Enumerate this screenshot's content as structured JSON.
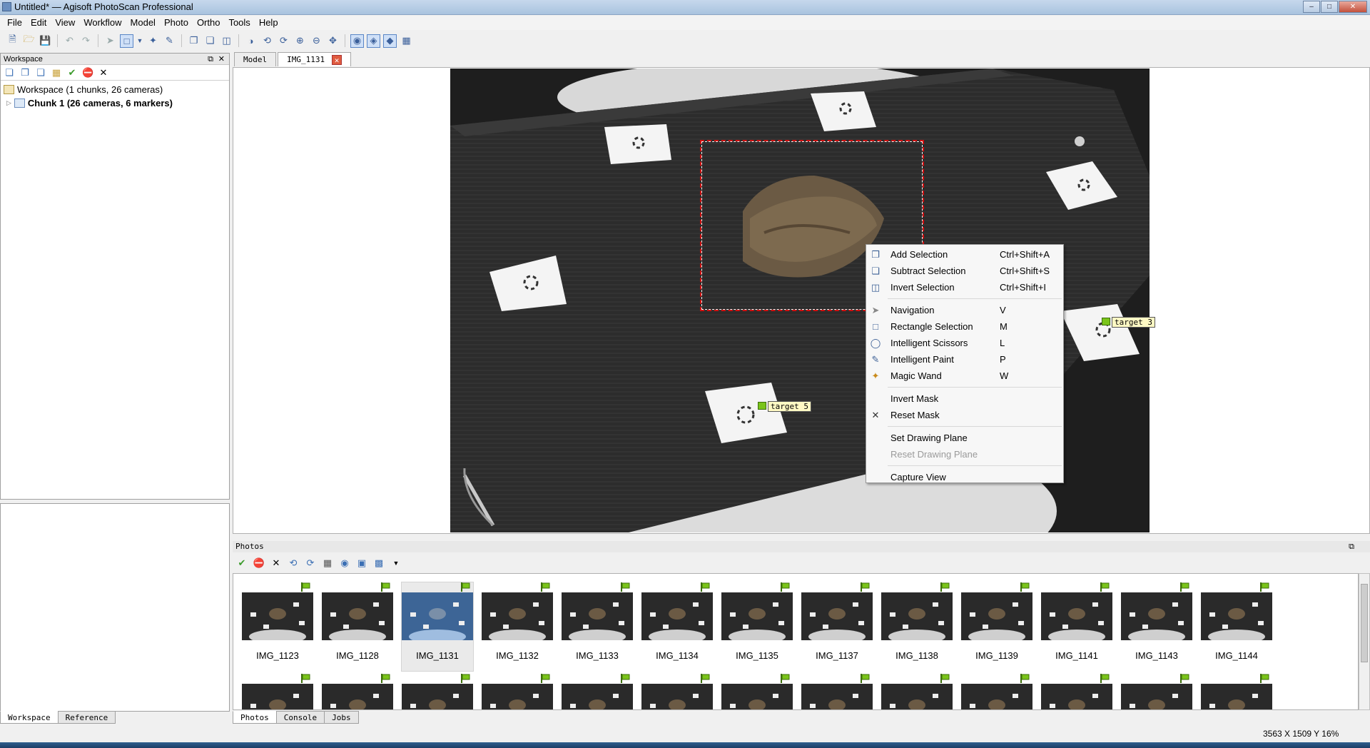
{
  "window": {
    "title": "Untitled* — Agisoft PhotoScan Professional"
  },
  "menu": [
    "File",
    "Edit",
    "View",
    "Workflow",
    "Model",
    "Photo",
    "Ortho",
    "Tools",
    "Help"
  ],
  "workspace": {
    "header": "Workspace",
    "root_label": "Workspace (1 chunks, 26 cameras)",
    "chunk_label": "Chunk 1 (26 cameras, 6 markers)"
  },
  "left_tabs": {
    "workspace": "Workspace",
    "reference": "Reference"
  },
  "doc_tabs": {
    "model": "Model",
    "image": "IMG_1131"
  },
  "markers": {
    "a": "target 5",
    "b": "target 3"
  },
  "context_menu": {
    "add_selection": {
      "label": "Add Selection",
      "shortcut": "Ctrl+Shift+A"
    },
    "subtract_selection": {
      "label": "Subtract Selection",
      "shortcut": "Ctrl+Shift+S"
    },
    "invert_selection": {
      "label": "Invert Selection",
      "shortcut": "Ctrl+Shift+I"
    },
    "navigation": {
      "label": "Navigation",
      "shortcut": "V"
    },
    "rectangle_selection": {
      "label": "Rectangle Selection",
      "shortcut": "M"
    },
    "intelligent_scissors": {
      "label": "Intelligent Scissors",
      "shortcut": "L"
    },
    "intelligent_paint": {
      "label": "Intelligent Paint",
      "shortcut": "P"
    },
    "magic_wand": {
      "label": "Magic Wand",
      "shortcut": "W"
    },
    "invert_mask": {
      "label": "Invert Mask"
    },
    "reset_mask": {
      "label": "Reset Mask"
    },
    "set_drawing_plane": {
      "label": "Set Drawing Plane"
    },
    "reset_drawing_plane": {
      "label": "Reset Drawing Plane"
    },
    "capture_view": {
      "label": "Capture View"
    }
  },
  "photos": {
    "header": "Photos",
    "row1": [
      "IMG_1123",
      "IMG_1128",
      "IMG_1131",
      "IMG_1132",
      "IMG_1133",
      "IMG_1134",
      "IMG_1135",
      "IMG_1137",
      "IMG_1138",
      "IMG_1139",
      "IMG_1141",
      "IMG_1143",
      "IMG_1144"
    ],
    "selected": "IMG_1131"
  },
  "bottom_tabs": {
    "photos": "Photos",
    "console": "Console",
    "jobs": "Jobs"
  },
  "status": {
    "coords": "3563 X  1509 Y  16%"
  },
  "colors": {
    "mask_rect": "#d01010",
    "marker_flag": "#7ac41a",
    "selection": "#5a86c6"
  },
  "icons": [
    "new-icon",
    "open-icon",
    "save-icon",
    "undo-icon",
    "redo-icon",
    "navigation-icon",
    "rect-select-icon",
    "zoom-in-icon",
    "zoom-out-icon",
    "add-chunk-icon",
    "enable-icon",
    "disable-icon",
    "remove-icon",
    "flag-icon"
  ]
}
